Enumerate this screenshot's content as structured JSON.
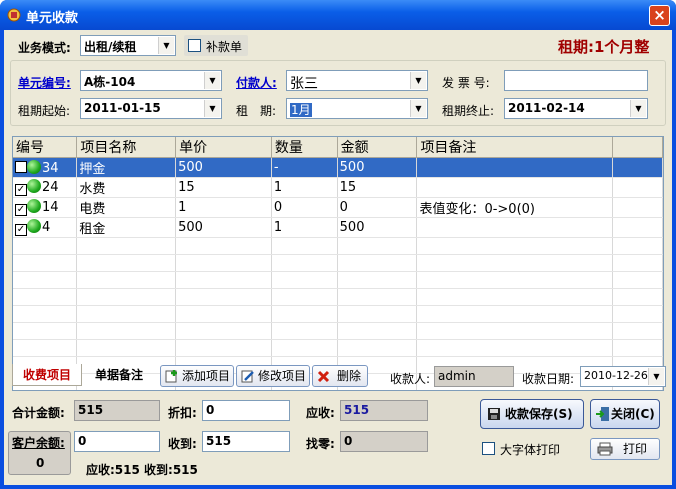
{
  "window": {
    "title": "单元收款",
    "close_symbol": "×"
  },
  "top": {
    "business_mode_label": "业务模式:",
    "business_mode_value": "出租/续租",
    "supplement_label": "补款单",
    "period_banner": "租期:1个月整"
  },
  "form": {
    "unit_no_label": "单元编号:",
    "unit_no_value": "A栋-104",
    "payer_label": "付款人:",
    "payer_value": "张三",
    "invoice_label": "发 票 号:",
    "invoice_value": "",
    "start_label": "租期起始:",
    "start_value": "2011-01-15",
    "period_label": "租　期:",
    "period_value": "1月",
    "end_label": "租期终止:",
    "end_value": "2011-02-14"
  },
  "grid": {
    "headers": [
      "编号",
      "项目名称",
      "单价",
      "数量",
      "金额",
      "项目备注"
    ],
    "rows": [
      {
        "checked": "",
        "id": "34",
        "name": "押金",
        "price": "500",
        "qty": "-",
        "amount": "500",
        "note": ""
      },
      {
        "checked": "✓",
        "id": "24",
        "name": "水费",
        "price": "15",
        "qty": "1",
        "amount": "15",
        "note": ""
      },
      {
        "checked": "✓",
        "id": "14",
        "name": "电费",
        "price": "1",
        "qty": "0",
        "amount": "0",
        "note": "表值变化：0->0(0)"
      },
      {
        "checked": "✓",
        "id": "4",
        "name": "租金",
        "price": "500",
        "qty": "1",
        "amount": "500",
        "note": ""
      }
    ]
  },
  "tabs": {
    "charge_items": "收费项目",
    "bill_notes": "单据备注"
  },
  "actions": {
    "add_item": "添加项目",
    "edit_item": "修改项目",
    "delete": "删除",
    "collector_label": "收款人:",
    "collector_value": "admin",
    "date_label": "收款日期:",
    "date_value": "2010-12-26"
  },
  "totals": {
    "total_label": "合计金额:",
    "total_value": "515",
    "discount_label": "折扣:",
    "discount_value": "0",
    "receivable_label": "应收:",
    "receivable_value": "515",
    "customer_balance_label": "客户余额:",
    "customer_balance_input": "0",
    "customer_balance_value": "0",
    "received_label": "收到:",
    "received_value": "515",
    "change_label": "找零:",
    "change_value": "0",
    "summary": "应收:515 收到:515"
  },
  "buttons": {
    "save": "收款保存(S)",
    "close": "关闭(C)",
    "large_font": "大字体打印",
    "print": "打印"
  },
  "colors": {
    "title_bar": "#0a5ee8",
    "banner": "#a00000",
    "selection": "#316ac5"
  }
}
